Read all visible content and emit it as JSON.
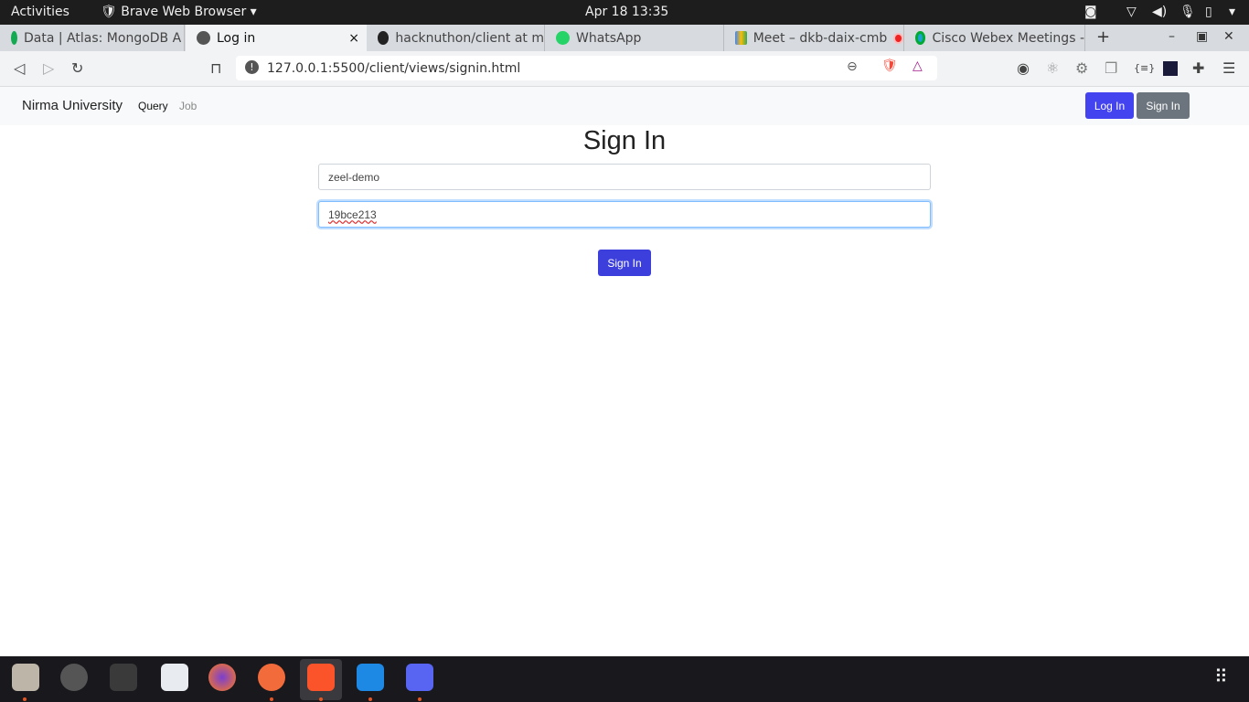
{
  "system": {
    "activities": "Activities",
    "app_menu": "Brave Web Browser ▾",
    "clock": "Apr 18  13:35"
  },
  "browser": {
    "tabs": [
      {
        "label": "Data | Atlas: MongoDB A",
        "icon": "mongodb-leaf-icon"
      },
      {
        "label": "Log in",
        "icon": "globe-icon",
        "active": true
      },
      {
        "label": "hacknuthon/client at m",
        "icon": "github-icon"
      },
      {
        "label": "WhatsApp",
        "icon": "whatsapp-icon"
      },
      {
        "label": "Meet – dkb-daix-cmb",
        "icon": "google-meet-icon"
      },
      {
        "label": "Cisco Webex Meetings -",
        "icon": "webex-icon"
      }
    ],
    "close_tab": "×",
    "new_tab": "+",
    "url": "127.0.0.1:5500/client/views/signin.html"
  },
  "navbar": {
    "brand": "Nirma University",
    "links": [
      "Query",
      "Job"
    ],
    "login": "Log In",
    "signin": "Sign In"
  },
  "colors": {
    "primary": "#4343f0",
    "secondary": "#6c757d",
    "submit": "#3c3fdc"
  },
  "form": {
    "title": "Sign In",
    "username": "zeel-demo",
    "password": "19bce213",
    "submit": "Sign In"
  },
  "dock": [
    "files-icon",
    "clock-icon",
    "terminal-icon",
    "text-editor-icon",
    "firefox-icon",
    "postman-icon",
    "brave-icon",
    "vscode-icon",
    "discord-icon"
  ]
}
